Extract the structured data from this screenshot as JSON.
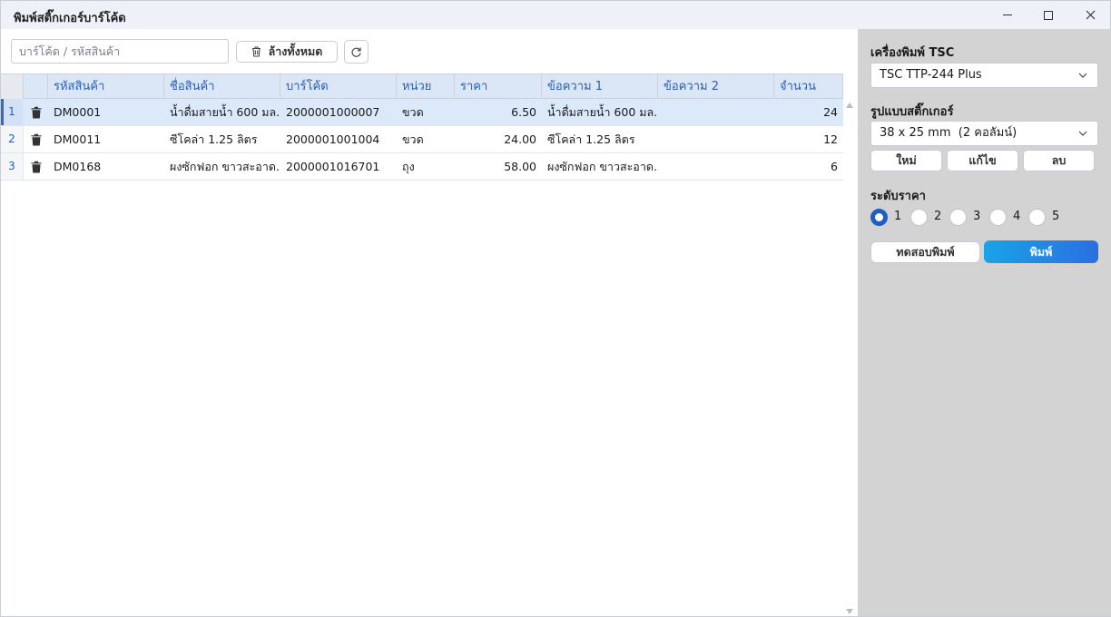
{
  "window": {
    "title": "พิมพ์สติ๊กเกอร์บาร์โค้ด"
  },
  "toolbar": {
    "search_placeholder": "บาร์โค้ด / รหัสสินค้า",
    "clear_all_label": "ล้างทั้งหมด"
  },
  "grid": {
    "columns": [
      "รหัสสินค้า",
      "ชื่อสินค้า",
      "บาร์โค้ด",
      "หน่วย",
      "ราคา",
      "ข้อความ 1",
      "ข้อความ 2",
      "จำนวน"
    ],
    "rows": [
      {
        "num": "1",
        "code": "DM0001",
        "name": "น้ำดื่มสายน้ำ 600 มล.",
        "barcode": "2000001000007",
        "unit": "ขวด",
        "price": "6.50",
        "text1": "น้ำดื่มสายน้ำ 600 มล.",
        "text2": "",
        "qty": "24"
      },
      {
        "num": "2",
        "code": "DM0011",
        "name": "ซีโคล่า 1.25 ลิตร",
        "barcode": "2000001001004",
        "unit": "ขวด",
        "price": "24.00",
        "text1": "ซีโคล่า 1.25 ลิตร",
        "text2": "",
        "qty": "12"
      },
      {
        "num": "3",
        "code": "DM0168",
        "name": "ผงซักฟอก ขาวสะอาด...",
        "barcode": "2000001016701",
        "unit": "ถุง",
        "price": "58.00",
        "text1": "ผงซักฟอก ขาวสะอาด...",
        "text2": "",
        "qty": "6"
      }
    ],
    "selected_row": 1
  },
  "panel": {
    "printer_label": "เครื่องพิมพ์ TSC",
    "printer_value": "TSC TTP-244 Plus",
    "format_label": "รูปแบบสติ๊กเกอร์",
    "format_value": "38 x 25 mm  (2 คอลัมน์)",
    "new_label": "ใหม่",
    "edit_label": "แก้ไข",
    "delete_label": "ลบ",
    "price_level_label": "ระดับราคา",
    "price_levels": [
      "1",
      "2",
      "3",
      "4",
      "5"
    ],
    "selected_price_level": "1",
    "test_print_label": "ทดสอบพิมพ์",
    "print_label": "พิมพ์"
  },
  "colors": {
    "accent": "#1f5fc4",
    "header_bg": "#dbe6f7",
    "header_text": "#2a5fb0",
    "panel_bg": "#d3d3d3",
    "print_gradient_start": "#1aa3e8",
    "print_gradient_end": "#2a6fe0"
  },
  "icons": {
    "clear": "trash-icon",
    "refresh": "refresh-icon",
    "row_delete": "trash-icon",
    "dropdown": "chevron-down-icon"
  }
}
